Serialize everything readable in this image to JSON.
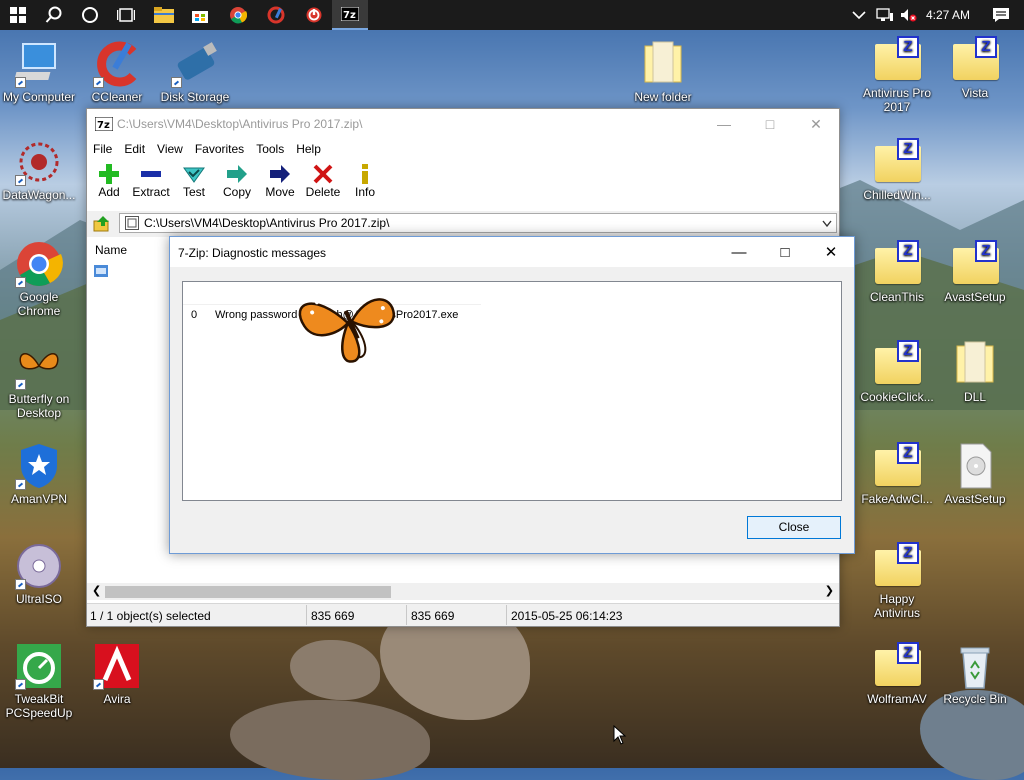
{
  "taskbar": {
    "clock": "4:27 AM",
    "apps": [
      "start-icon",
      "search-icon",
      "cortana-icon",
      "task-view-icon",
      "file-explorer-icon",
      "store-icon",
      "chrome-icon",
      "ccleaner-icon",
      "mirekusoft-icon",
      "7zip-icon"
    ]
  },
  "desktop": {
    "left_icons": [
      {
        "label": "My Computer"
      },
      {
        "label": "CCleaner"
      },
      {
        "label": "Disk Storage"
      },
      {
        "label": "DataWagon..."
      },
      {
        "label": "Google Chrome"
      },
      {
        "label": "Butterfly on Desktop"
      },
      {
        "label": "AmanVPN"
      },
      {
        "label": "UltraISO"
      },
      {
        "label": "TweakBit PCSpeedUp"
      },
      {
        "label": "Avira"
      }
    ],
    "middle_icons": [
      {
        "label": "New folder"
      }
    ],
    "right_icons": [
      {
        "label": "Antivirus Pro 2017"
      },
      {
        "label": "Vista"
      },
      {
        "label": "ChilledWin..."
      },
      {
        "label": "CleanThis"
      },
      {
        "label": "AvastSetup"
      },
      {
        "label": "CookieClick..."
      },
      {
        "label": "DLL"
      },
      {
        "label": "FakeAdwCl..."
      },
      {
        "label": "AvastSetup"
      },
      {
        "label": "Happy Antivirus"
      },
      {
        "label": "WolframAV"
      },
      {
        "label": "Recycle Bin"
      }
    ]
  },
  "main_window": {
    "title": "C:\\Users\\VM4\\Desktop\\Antivirus Pro 2017.zip\\",
    "menu": [
      "File",
      "Edit",
      "View",
      "Favorites",
      "Tools",
      "Help"
    ],
    "toolbar": [
      {
        "label": "Add",
        "icon": "plus-icon",
        "color": "#22bb22"
      },
      {
        "label": "Extract",
        "icon": "minus-icon",
        "color": "#1a2fa8"
      },
      {
        "label": "Test",
        "icon": "check-icon",
        "color": "#2ab5b5"
      },
      {
        "label": "Copy",
        "icon": "copy-arrow-icon",
        "color": "#22a08a"
      },
      {
        "label": "Move",
        "icon": "move-arrow-icon",
        "color": "#14207a"
      },
      {
        "label": "Delete",
        "icon": "x-icon",
        "color": "#d01414"
      },
      {
        "label": "Info",
        "icon": "info-icon",
        "color": "#c8a800"
      }
    ],
    "address": "C:\\Users\\VM4\\Desktop\\Antivirus Pro 2017.zip\\",
    "column_name": "Name",
    "status": {
      "selected": "1 / 1 object(s) selected",
      "size": "835 669",
      "packed": "835 669",
      "modified": "2015-05-25 06:14:23"
    }
  },
  "dialog": {
    "title": "7-Zip: Diagnostic messages",
    "rows": [
      {
        "index": "0",
        "message": "Wrong password : Launch@AntivirusPro2017.exe"
      }
    ],
    "close_label": "Close"
  }
}
